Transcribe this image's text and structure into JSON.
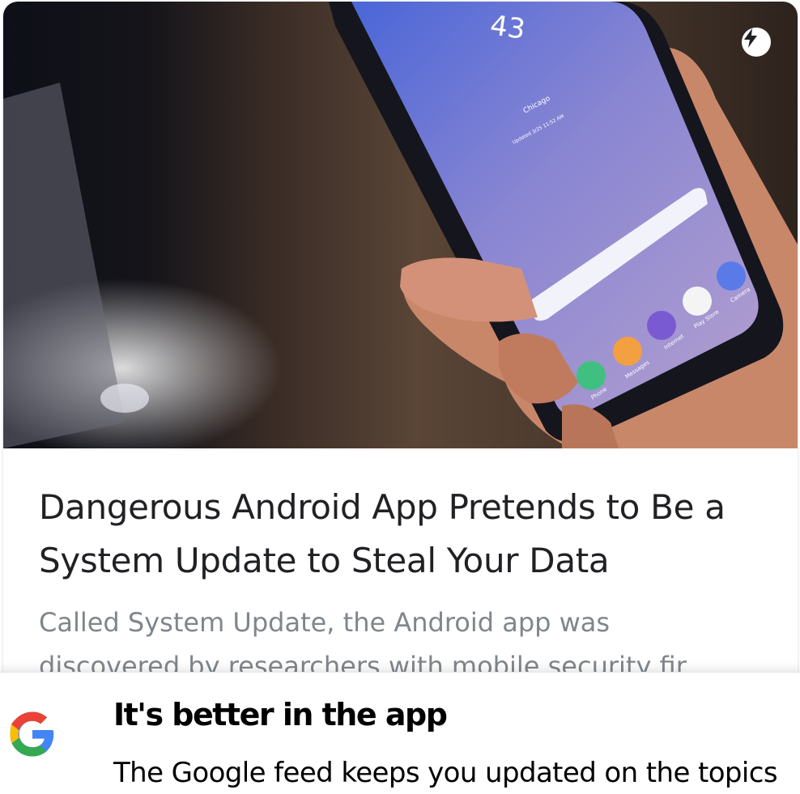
{
  "article": {
    "headline": "Dangerous Android App Pretends to Be a System Update to Steal Your Data",
    "snippet": "Called System Update, the Android app was discovered by researchers with mobile security fir..."
  },
  "hero_image": {
    "phone_time": "43",
    "city": "Chicago",
    "updated": "Updated 3/25 11:52 AM",
    "apps": [
      "Phone",
      "Messages",
      "Internet",
      "Play Store",
      "Camera"
    ]
  },
  "app_banner": {
    "title": "It's better in the app",
    "text": "The Google feed keeps you updated on the topics"
  },
  "icons": {
    "amp": "amp-lightning-icon",
    "google": "google-g-logo"
  },
  "colors": {
    "headline": "#202124",
    "snippet": "#80868b",
    "google_blue": "#4285F4",
    "google_red": "#EA4335",
    "google_yellow": "#FBBC05",
    "google_green": "#34A853"
  }
}
